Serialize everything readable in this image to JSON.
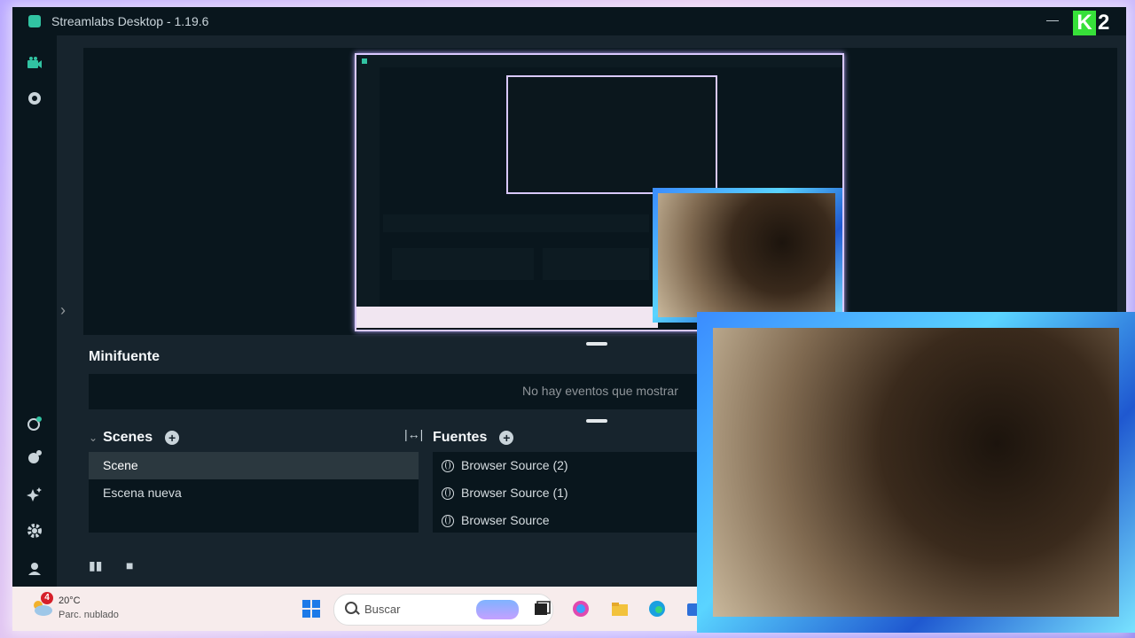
{
  "window": {
    "title": "Streamlabs Desktop - 1.19.6"
  },
  "overlay": {
    "logo_letter": "K",
    "logo_number": "2"
  },
  "sidebar": {
    "items": [
      {
        "name": "editor-icon",
        "color": "#31c3a2"
      },
      {
        "name": "record-icon"
      },
      {
        "name": "theme-icon"
      },
      {
        "name": "apps-icon"
      },
      {
        "name": "highlight-icon"
      },
      {
        "name": "settings-icon"
      },
      {
        "name": "account-icon"
      }
    ]
  },
  "minifuente": {
    "title": "Minifuente",
    "empty_text": "No hay eventos que mostrar"
  },
  "scenes": {
    "title": "Scenes",
    "items": [
      "Scene",
      "Escena nueva"
    ]
  },
  "sources": {
    "title": "Fuentes",
    "items": [
      "Browser Source (2)",
      "Browser Source (1)",
      "Browser Source"
    ]
  },
  "taskbar": {
    "weather": {
      "badge": "4",
      "temp": "20°C",
      "condition": "Parc. nublado"
    },
    "search_placeholder": "Buscar"
  }
}
